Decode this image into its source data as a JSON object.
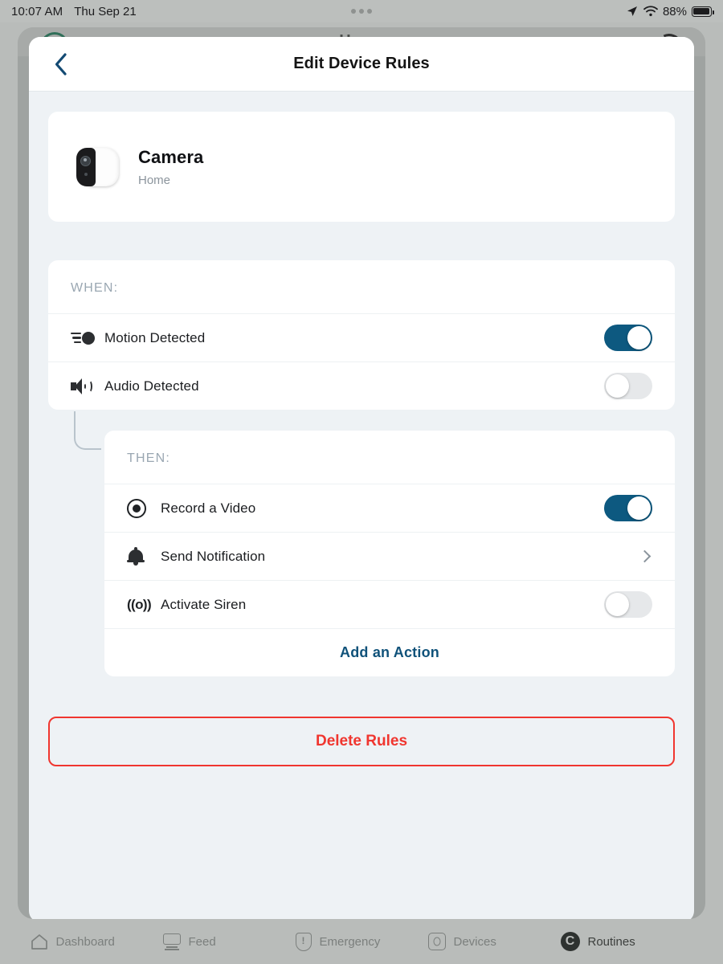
{
  "statusbar": {
    "time": "10:07 AM",
    "date": "Thu Sep 21",
    "battery_percent": "88%",
    "location_icon": "location-arrow-icon",
    "wifi_icon": "wifi-icon",
    "battery_icon": "battery-icon",
    "dots_icon": "more-dots-icon"
  },
  "background_page": {
    "title": "Home"
  },
  "header": {
    "title": "Edit Device Rules",
    "back_icon": "chevron-left-icon"
  },
  "device": {
    "name": "Camera",
    "room": "Home",
    "icon": "security-camera-icon"
  },
  "when_section": {
    "label": "WHEN:",
    "rows": [
      {
        "label": "Motion Detected",
        "icon": "motion-icon",
        "control": "toggle",
        "state": "on"
      },
      {
        "label": "Audio Detected",
        "icon": "audio-speaker-icon",
        "control": "toggle",
        "state": "off"
      }
    ]
  },
  "then_section": {
    "label": "THEN:",
    "rows": [
      {
        "label": "Record a Video",
        "icon": "record-icon",
        "control": "toggle",
        "state": "on"
      },
      {
        "label": "Send Notification",
        "icon": "bell-icon",
        "control": "chevron",
        "state": ""
      },
      {
        "label": "Activate Siren",
        "icon": "siren-icon",
        "control": "toggle",
        "state": "off"
      }
    ],
    "add_action_label": "Add an Action"
  },
  "delete_button": {
    "label": "Delete Rules"
  },
  "tabbar": {
    "items": [
      {
        "label": "Dashboard",
        "icon": "home-icon",
        "active": false
      },
      {
        "label": "Feed",
        "icon": "monitor-icon",
        "active": false
      },
      {
        "label": "Emergency",
        "icon": "shield-alert-icon",
        "active": false
      },
      {
        "label": "Devices",
        "icon": "device-scan-icon",
        "active": false
      },
      {
        "label": "Routines",
        "icon": "routines-c-icon",
        "active": true
      }
    ]
  },
  "colors": {
    "accent_blue": "#0d5980",
    "link_blue": "#10527a",
    "danger_red": "#f0362f",
    "page_bg": "#eef2f5",
    "card_bg": "#ffffff",
    "muted_text": "#9aa7b2"
  }
}
